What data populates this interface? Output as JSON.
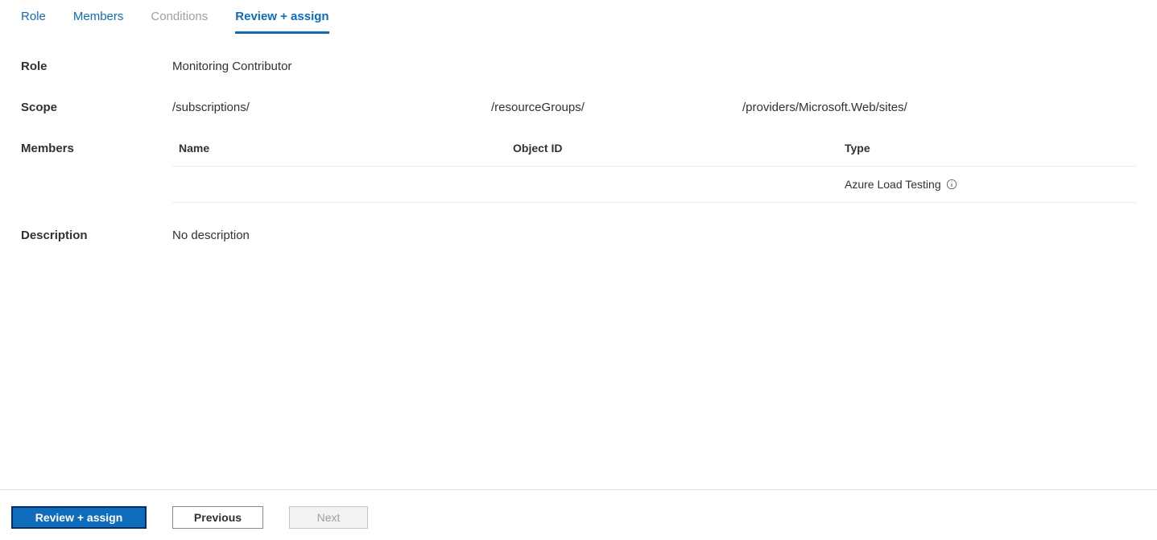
{
  "tabs": {
    "role": "Role",
    "members": "Members",
    "conditions": "Conditions",
    "review_assign": "Review + assign"
  },
  "fields": {
    "role": {
      "label": "Role",
      "value": "Monitoring Contributor"
    },
    "scope": {
      "label": "Scope",
      "part1": "/subscriptions/",
      "part2": "/resourceGroups/",
      "part3": "/providers/Microsoft.Web/sites/"
    },
    "members": {
      "label": "Members",
      "columns": {
        "name": "Name",
        "object_id": "Object ID",
        "type": "Type"
      },
      "rows": [
        {
          "name": "",
          "object_id": "",
          "type": "Azure Load Testing"
        }
      ]
    },
    "description": {
      "label": "Description",
      "value": "No description"
    }
  },
  "footer": {
    "review_assign": "Review + assign",
    "previous": "Previous",
    "next": "Next"
  }
}
